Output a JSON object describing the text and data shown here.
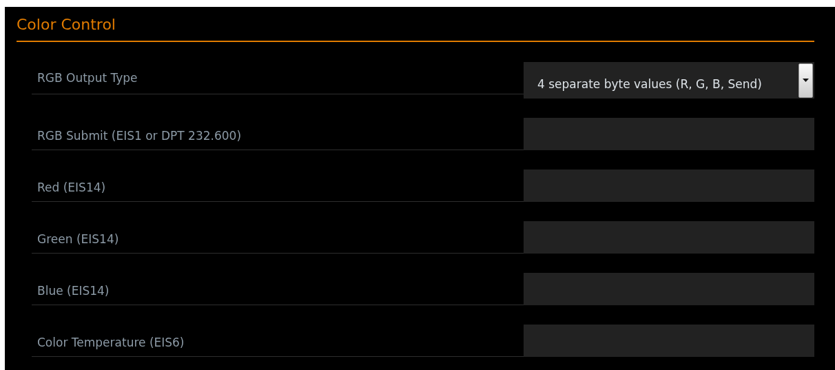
{
  "panel": {
    "title": "Color Control"
  },
  "rows": [
    {
      "kind": "select",
      "label": "RGB Output Type",
      "value": "4 separate byte values (R, G, B, Send)"
    },
    {
      "kind": "text",
      "label": "RGB Submit (EIS1 or DPT 232.600)"
    },
    {
      "kind": "text",
      "label": "Red (EIS14)"
    },
    {
      "kind": "text",
      "label": "Green (EIS14)"
    },
    {
      "kind": "text",
      "label": "Blue (EIS14)"
    },
    {
      "kind": "text",
      "label": "Color Temperature (EIS6)"
    }
  ]
}
